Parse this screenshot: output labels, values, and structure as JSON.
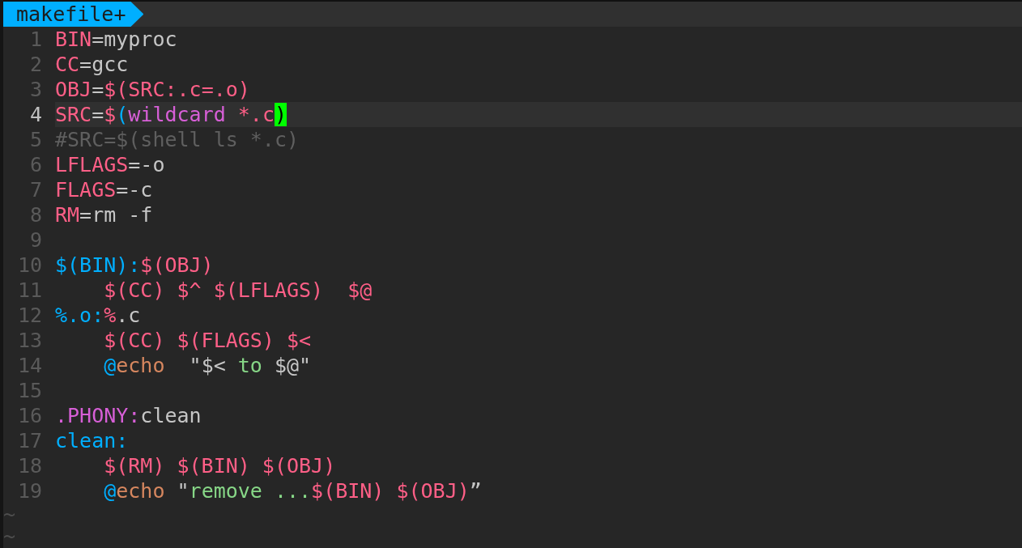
{
  "tab": {
    "label": "makefile+"
  },
  "lines": [
    {
      "number": "1",
      "current": false,
      "tokens": [
        {
          "text": "BIN",
          "kind": "var"
        },
        {
          "text": "=myproc",
          "kind": "plain"
        }
      ]
    },
    {
      "number": "2",
      "current": false,
      "tokens": [
        {
          "text": "CC",
          "kind": "var"
        },
        {
          "text": "=gcc",
          "kind": "plain"
        }
      ]
    },
    {
      "number": "3",
      "current": false,
      "tokens": [
        {
          "text": "OBJ",
          "kind": "var"
        },
        {
          "text": "=",
          "kind": "plain"
        },
        {
          "text": "$(SRC:.c=.o)",
          "kind": "var"
        }
      ]
    },
    {
      "number": "4",
      "current": true,
      "tokens": [
        {
          "text": "SRC",
          "kind": "var"
        },
        {
          "text": "=",
          "kind": "plain"
        },
        {
          "text": "$",
          "kind": "var"
        },
        {
          "text": "(",
          "kind": "target"
        },
        {
          "text": "wildcard",
          "kind": "func"
        },
        {
          "text": " *.c",
          "kind": "var"
        },
        {
          "text": ")",
          "kind": "cursor"
        }
      ]
    },
    {
      "number": "5",
      "current": false,
      "tokens": [
        {
          "text": "#SRC=$(shell ls *.c)",
          "kind": "comment"
        }
      ]
    },
    {
      "number": "6",
      "current": false,
      "tokens": [
        {
          "text": "LFLAGS",
          "kind": "var"
        },
        {
          "text": "=-o",
          "kind": "plain"
        }
      ]
    },
    {
      "number": "7",
      "current": false,
      "tokens": [
        {
          "text": "FLAGS",
          "kind": "var"
        },
        {
          "text": "=-c",
          "kind": "plain"
        }
      ]
    },
    {
      "number": "8",
      "current": false,
      "tokens": [
        {
          "text": "RM",
          "kind": "var"
        },
        {
          "text": "=rm -f",
          "kind": "plain"
        }
      ]
    },
    {
      "number": "9",
      "current": false
    },
    {
      "number": "10",
      "current": false,
      "tokens": [
        {
          "text": "$(BIN):",
          "kind": "target"
        },
        {
          "text": "$(OBJ)",
          "kind": "var"
        }
      ]
    },
    {
      "number": "11",
      "current": false,
      "tokens": [
        {
          "text": "    $(CC) $^ $(LFLAGS)  $@",
          "kind": "var"
        }
      ]
    },
    {
      "number": "12",
      "current": false,
      "tokens": [
        {
          "text": "%.o:",
          "kind": "target"
        },
        {
          "text": "%",
          "kind": "var"
        },
        {
          "text": ".c",
          "kind": "plain"
        }
      ]
    },
    {
      "number": "13",
      "current": false,
      "tokens": [
        {
          "text": "    $(CC) $(FLAGS) $<",
          "kind": "var"
        }
      ]
    },
    {
      "number": "14",
      "current": false,
      "tokens": [
        {
          "text": "    @",
          "kind": "target"
        },
        {
          "text": "echo",
          "kind": "command"
        },
        {
          "text": "  \"$< ",
          "kind": "plain"
        },
        {
          "text": "to",
          "kind": "string"
        },
        {
          "text": " $@\"",
          "kind": "plain"
        }
      ]
    },
    {
      "number": "15",
      "current": false
    },
    {
      "number": "16",
      "current": false,
      "tokens": [
        {
          "text": ".PHONY:",
          "kind": "func"
        },
        {
          "text": "clean",
          "kind": "plain"
        }
      ]
    },
    {
      "number": "17",
      "current": false,
      "tokens": [
        {
          "text": "clean:",
          "kind": "target"
        }
      ]
    },
    {
      "number": "18",
      "current": false,
      "tokens": [
        {
          "text": "    $(RM) $(BIN) $(OBJ)",
          "kind": "var"
        }
      ]
    },
    {
      "number": "19",
      "current": false,
      "tokens": [
        {
          "text": "    @",
          "kind": "target"
        },
        {
          "text": "echo",
          "kind": "command"
        },
        {
          "text": " \"",
          "kind": "plain"
        },
        {
          "text": "remove ...",
          "kind": "string"
        },
        {
          "text": "$(BIN) $(OBJ)",
          "kind": "var"
        },
        {
          "text": "”",
          "kind": "plain"
        }
      ]
    }
  ],
  "filler": [
    "~",
    "~"
  ]
}
